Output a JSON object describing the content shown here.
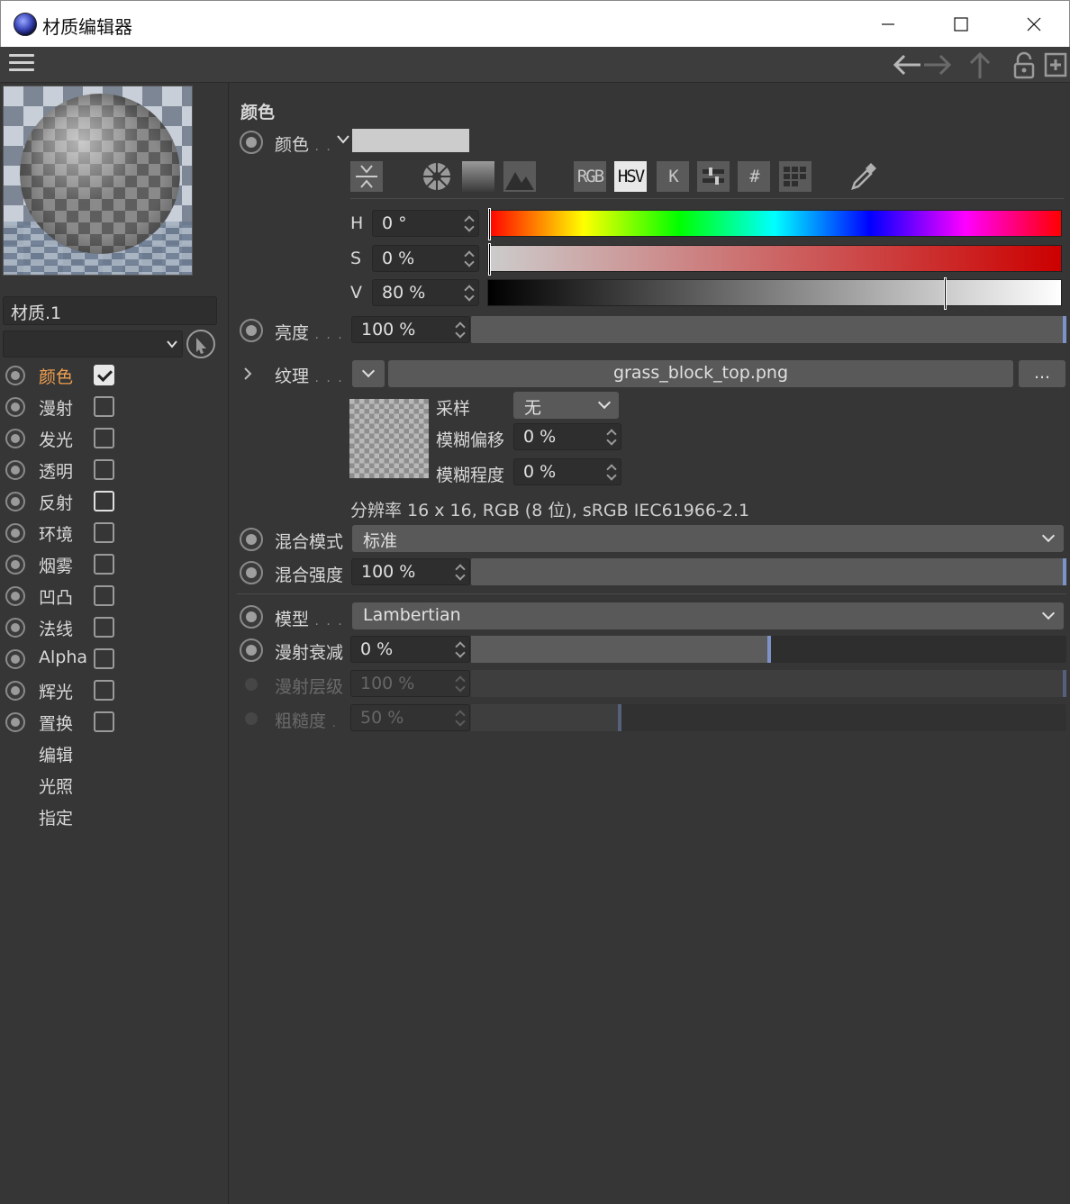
{
  "window": {
    "title": "材质编辑器"
  },
  "sidebar": {
    "material_name": "材质.1",
    "channels": [
      {
        "label": "颜色",
        "checked": true,
        "active": true
      },
      {
        "label": "漫射",
        "checked": false
      },
      {
        "label": "发光",
        "checked": false
      },
      {
        "label": "透明",
        "checked": false
      },
      {
        "label": "反射",
        "checked": false
      },
      {
        "label": "环境",
        "checked": false
      },
      {
        "label": "烟雾",
        "checked": false
      },
      {
        "label": "凹凸",
        "checked": false
      },
      {
        "label": "法线",
        "checked": false
      },
      {
        "label": "Alpha",
        "checked": false
      },
      {
        "label": "辉光",
        "checked": false
      },
      {
        "label": "置换",
        "checked": false
      }
    ],
    "nav_items": [
      "编辑",
      "光照",
      "指定"
    ]
  },
  "main": {
    "section_title": "颜色",
    "color": {
      "label": "颜色",
      "swatch": "#cccccc"
    },
    "tool_buttons": {
      "rgb": "RGB",
      "hsv": "HSV",
      "k": "K",
      "hex": "#"
    },
    "hsv": {
      "h": {
        "label": "H",
        "value": "0 °",
        "fraction": 0.0
      },
      "s": {
        "label": "S",
        "value": "0 %",
        "fraction": 0.0
      },
      "v": {
        "label": "V",
        "value": "80 %",
        "fraction": 0.8
      }
    },
    "brightness": {
      "label": "亮度",
      "value": "100 %",
      "fraction": 1.0
    },
    "texture": {
      "label": "纹理",
      "file": "grass_block_top.png",
      "more_label": "...",
      "sampling_label": "采样",
      "sampling_value": "无",
      "blur_offset_label": "模糊偏移",
      "blur_offset_value": "0 %",
      "blur_scale_label": "模糊程度",
      "blur_scale_value": "0 %",
      "resolution": "分辨率 16 x 16, RGB (8 位), sRGB IEC61966-2.1"
    },
    "blend_mode": {
      "label": "混合模式",
      "value": "标准"
    },
    "blend_strength": {
      "label": "混合强度",
      "value": "100 %",
      "fraction": 1.0
    },
    "model": {
      "label": "模型",
      "value": "Lambertian"
    },
    "diffuse_falloff": {
      "label": "漫射衰减",
      "value": "0 %",
      "fraction": 0.5
    },
    "diffuse_level": {
      "label": "漫射层级",
      "value": "100 %",
      "fraction": 1.0
    },
    "roughness": {
      "label": "粗糙度",
      "value": "50 %",
      "fraction": 0.25
    }
  }
}
